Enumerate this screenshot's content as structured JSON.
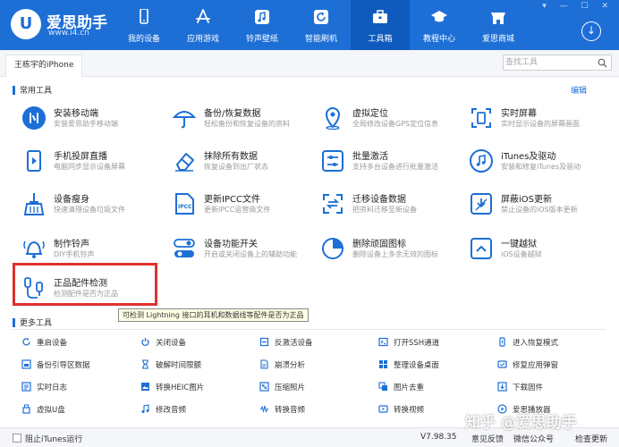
{
  "app": {
    "logo_mark": "U",
    "name": "爱思助手",
    "url": "www.i4.cn"
  },
  "nav": [
    {
      "label": "我的设备",
      "icon": "phone-icon"
    },
    {
      "label": "应用游戏",
      "icon": "app-store-icon"
    },
    {
      "label": "铃声壁纸",
      "icon": "music-icon"
    },
    {
      "label": "智能刷机",
      "icon": "refresh-icon"
    },
    {
      "label": "工具箱",
      "icon": "toolbox-icon",
      "active": true
    },
    {
      "label": "教程中心",
      "icon": "graduation-cap-icon"
    },
    {
      "label": "爱思商城",
      "icon": "shop-icon"
    }
  ],
  "device_tab": "王栋宇的iPhone",
  "search": {
    "placeholder": "查找工具"
  },
  "common_tools": {
    "title": "常用工具",
    "edit_label": "编辑",
    "items": [
      {
        "name": "安装移动端",
        "desc": "安装爱思助手移动端",
        "icon": "install-mobile-icon"
      },
      {
        "name": "备份/恢复数据",
        "desc": "轻松备份和恢复设备的资料",
        "icon": "umbrella-icon"
      },
      {
        "name": "虚拟定位",
        "desc": "全局修改设备GPS定位信息",
        "icon": "location-pin-icon"
      },
      {
        "name": "实时屏幕",
        "desc": "实时显示设备的屏幕画面",
        "icon": "screen-capture-icon"
      },
      {
        "name": "手机投屏直播",
        "desc": "电脑同步显示设备屏幕",
        "icon": "cast-screen-icon"
      },
      {
        "name": "抹除所有数据",
        "desc": "恢复设备到出厂状态",
        "icon": "eraser-icon"
      },
      {
        "name": "批量激活",
        "desc": "支持多台设备进行批量激活",
        "icon": "sliders-icon"
      },
      {
        "name": "iTunes及驱动",
        "desc": "安装和修复iTunes及驱动",
        "icon": "itunes-icon"
      },
      {
        "name": "设备瘦身",
        "desc": "快速清理设备垃圾文件",
        "icon": "broom-icon"
      },
      {
        "name": "更新IPCC文件",
        "desc": "更新IPCC运营商文件",
        "icon": "ipcc-file-icon"
      },
      {
        "name": "迁移设备数据",
        "desc": "把资料迁移至新设备",
        "icon": "migrate-data-icon"
      },
      {
        "name": "屏蔽iOS更新",
        "desc": "禁止设备的iOS版本更新",
        "icon": "block-update-icon"
      },
      {
        "name": "制作铃声",
        "desc": "DIY手机铃声",
        "icon": "bell-icon"
      },
      {
        "name": "设备功能开关",
        "desc": "开启或关闭设备上的辅助功能",
        "icon": "toggle-icon"
      },
      {
        "name": "删除顽固图标",
        "desc": "删除设备上多余无效的图标",
        "icon": "pie-chart-icon"
      },
      {
        "name": "一键越狱",
        "desc": "iOS设备越狱",
        "icon": "unlock-icon"
      },
      {
        "name": "正品配件检测",
        "desc": "检测配件是否为正品",
        "icon": "cable-icon"
      }
    ]
  },
  "tooltip": "可检测 Lightning 接口的耳机和数据线等配件是否为正品",
  "more_tools": {
    "title": "更多工具",
    "items": [
      {
        "label": "重启设备",
        "icon": "restart-icon"
      },
      {
        "label": "关闭设备",
        "icon": "power-icon"
      },
      {
        "label": "反激活设备",
        "icon": "deactivate-icon"
      },
      {
        "label": "打开SSH通道",
        "icon": "ssh-icon"
      },
      {
        "label": "进入恢复模式",
        "icon": "recovery-icon"
      },
      {
        "label": "备份引导区数据",
        "icon": "backup-boot-icon"
      },
      {
        "label": "破解时间限额",
        "icon": "hourglass-icon"
      },
      {
        "label": "崩溃分析",
        "icon": "crash-analysis-icon"
      },
      {
        "label": "整理设备桌面",
        "icon": "organize-desktop-icon"
      },
      {
        "label": "修复应用弹窗",
        "icon": "fix-popup-icon"
      },
      {
        "label": "实时日志",
        "icon": "log-icon"
      },
      {
        "label": "转换HEIC图片",
        "icon": "heic-icon"
      },
      {
        "label": "压缩照片",
        "icon": "compress-photo-icon"
      },
      {
        "label": "图片去重",
        "icon": "dedupe-icon"
      },
      {
        "label": "下载固件",
        "icon": "firmware-download-icon"
      },
      {
        "label": "虚拟U盘",
        "icon": "usb-drive-icon"
      },
      {
        "label": "修改音频",
        "icon": "audio-edit-icon"
      },
      {
        "label": "转换音频",
        "icon": "audio-convert-icon"
      },
      {
        "label": "转换视频",
        "icon": "video-convert-icon"
      },
      {
        "label": "爱思播放器",
        "icon": "player-icon"
      }
    ]
  },
  "status": {
    "itunes_checkbox": "阻止iTunes运行",
    "version": "V7.98.35",
    "feedback": "意见反馈",
    "wechat": "微信公众号",
    "update": "检查更新"
  },
  "watermark": "知乎 @爱思助手",
  "colors": {
    "brand": "#1d6fd6",
    "highlight": "#e03030"
  }
}
